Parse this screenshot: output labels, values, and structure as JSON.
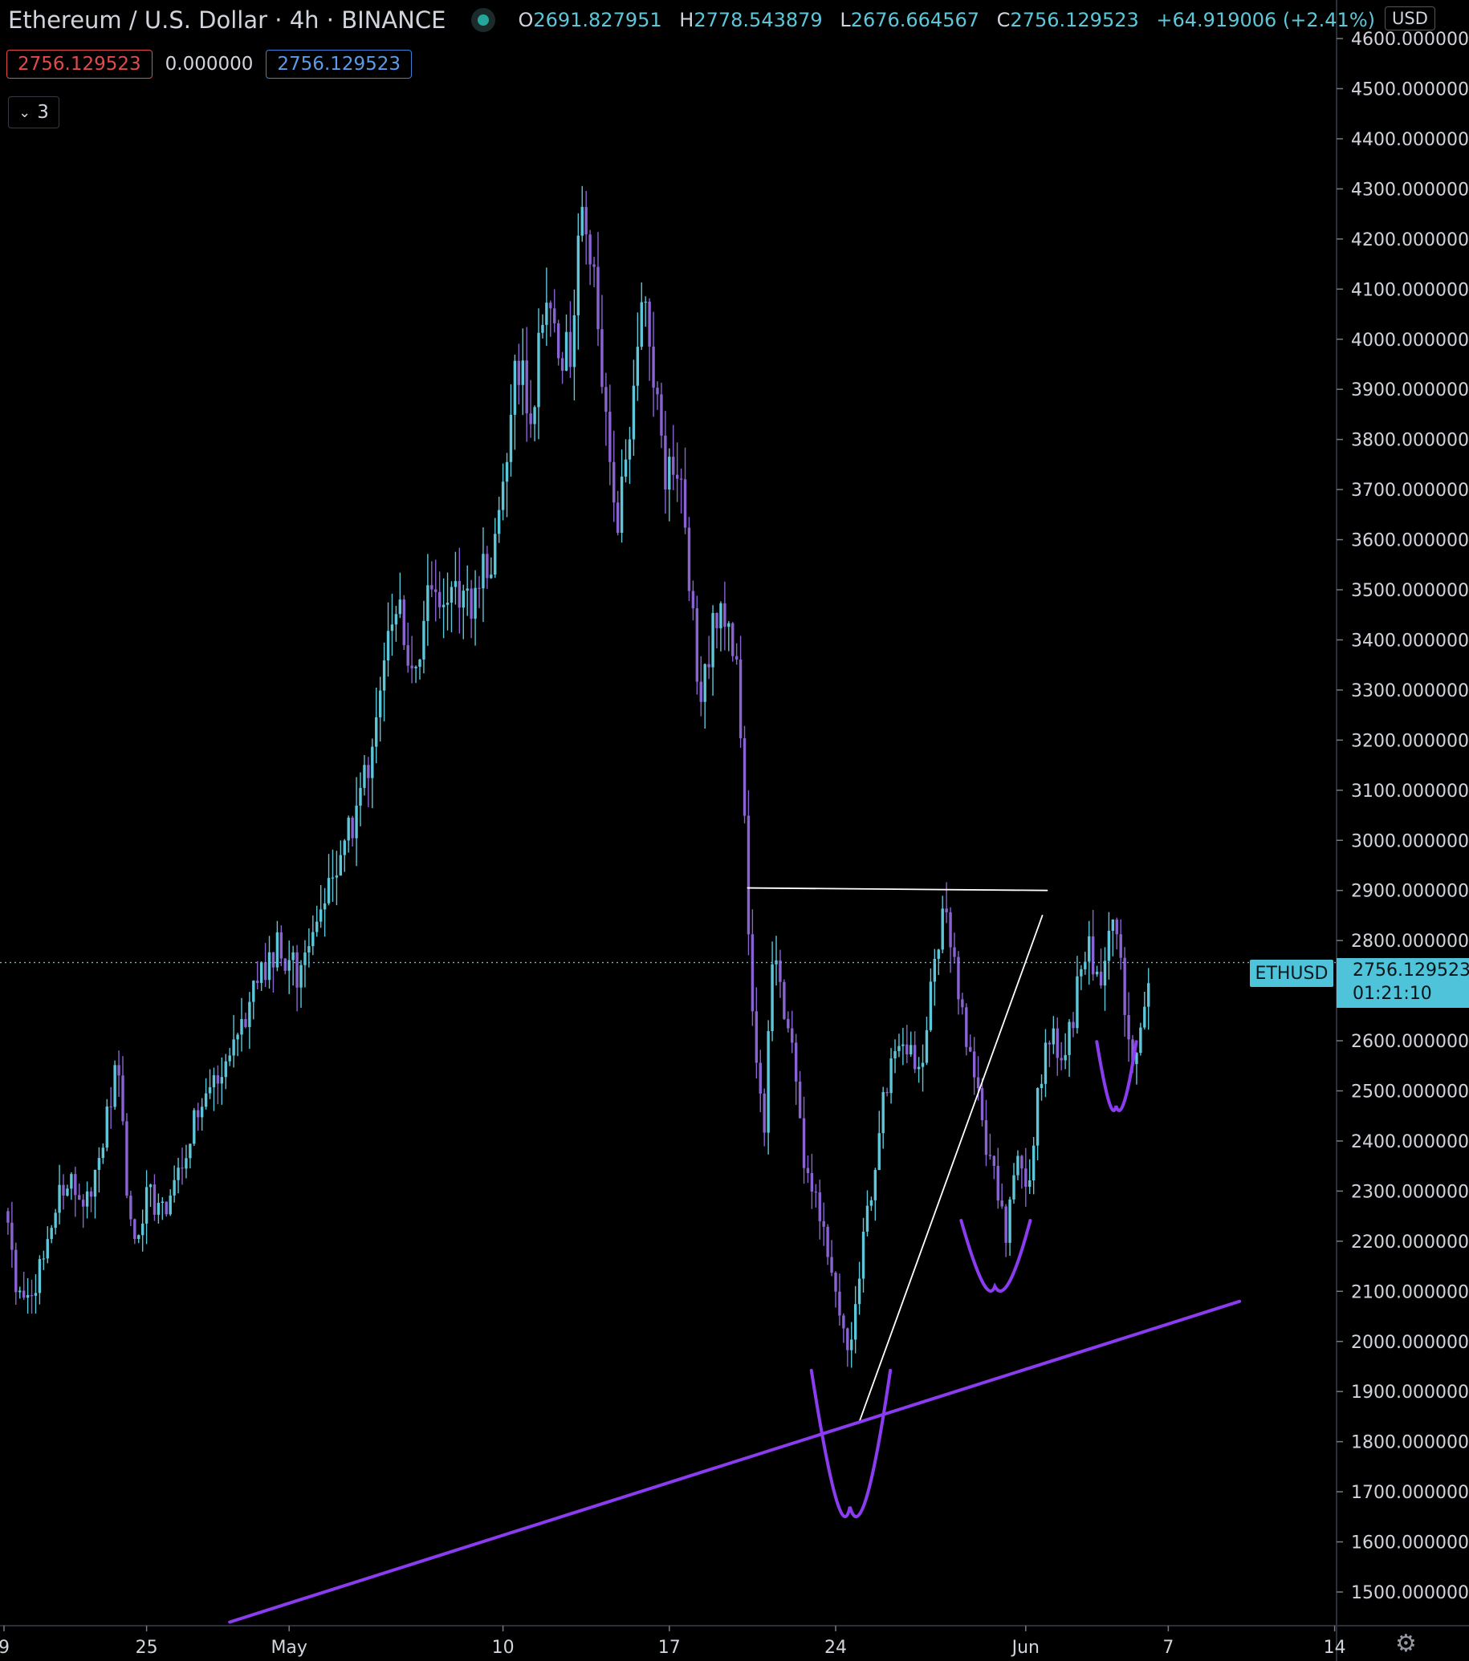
{
  "header": {
    "title": "Ethereum / U.S. Dollar · 4h · BINANCE",
    "ohlc": {
      "o_label": "O",
      "o": "2691.827951",
      "h_label": "H",
      "h": "2778.543879",
      "l_label": "L",
      "l": "2676.664567",
      "c_label": "C",
      "c": "2756.129523",
      "change": "+64.919006 (+2.41%)"
    }
  },
  "toolbar": {
    "bid": "2756.129523",
    "spread": "0.000000",
    "ask": "2756.129523",
    "indicator_count": "3"
  },
  "axis": {
    "currency": "USD"
  },
  "price_label": {
    "symbol": "ETHUSD",
    "price": "2756.129523",
    "countdown": "01:21:10"
  },
  "colors": {
    "background": "#000000",
    "candle_up": "#5dc6d8",
    "candle_down": "#8a63d2",
    "annotation_purple": "#8b3cf0",
    "annotation_white": "#ffffff",
    "last_price": "#4fc3d9"
  },
  "chart_data": {
    "type": "candlestick",
    "title": "Ethereum / U.S. Dollar · 4h · BINANCE",
    "y_axis": {
      "ylim": [
        1450,
        4700
      ],
      "ticks": [
        1500,
        1600,
        1700,
        1800,
        1900,
        2000,
        2100,
        2200,
        2300,
        2400,
        2500,
        2600,
        2700,
        2800,
        2900,
        3000,
        3100,
        3200,
        3300,
        3400,
        3500,
        3600,
        3700,
        3800,
        3900,
        4000,
        4100,
        4200,
        4300,
        4400,
        4500,
        4600
      ],
      "tick_format": "0.000000",
      "side": "right"
    },
    "x_axis": {
      "start_day": 19,
      "end_day": 57.6,
      "labels": [
        {
          "text": "9",
          "day": 19
        },
        {
          "text": "25",
          "day": 25
        },
        {
          "text": "May",
          "day": 31
        },
        {
          "text": "10",
          "day": 40
        },
        {
          "text": "17",
          "day": 47
        },
        {
          "text": "24",
          "day": 54
        },
        {
          "text": "Jun",
          "day": 62
        },
        {
          "text": "7",
          "day": 68
        },
        {
          "text": "14",
          "day": 75
        }
      ]
    },
    "close_path": [
      [
        19.0,
        2260
      ],
      [
        19.5,
        2120
      ],
      [
        20.2,
        2080
      ],
      [
        21.0,
        2250
      ],
      [
        21.8,
        2330
      ],
      [
        22.5,
        2280
      ],
      [
        23.2,
        2420
      ],
      [
        23.8,
        2560
      ],
      [
        24.2,
        2280
      ],
      [
        24.6,
        2180
      ],
      [
        25.0,
        2300
      ],
      [
        25.6,
        2250
      ],
      [
        26.2,
        2300
      ],
      [
        27.0,
        2430
      ],
      [
        27.8,
        2520
      ],
      [
        28.4,
        2580
      ],
      [
        29.0,
        2640
      ],
      [
        29.8,
        2720
      ],
      [
        30.6,
        2790
      ],
      [
        31.3,
        2730
      ],
      [
        32.0,
        2830
      ],
      [
        32.5,
        2910
      ],
      [
        33.0,
        2950
      ],
      [
        33.8,
        3040
      ],
      [
        34.5,
        3200
      ],
      [
        35.0,
        3380
      ],
      [
        35.6,
        3480
      ],
      [
        36.2,
        3300
      ],
      [
        37.0,
        3520
      ],
      [
        37.8,
        3490
      ],
      [
        38.5,
        3460
      ],
      [
        39.2,
        3550
      ],
      [
        39.8,
        3600
      ],
      [
        40.5,
        3960
      ],
      [
        41.2,
        3850
      ],
      [
        41.8,
        4080
      ],
      [
        42.3,
        4000
      ],
      [
        42.8,
        3960
      ],
      [
        43.3,
        4280
      ],
      [
        43.8,
        4120
      ],
      [
        44.3,
        3850
      ],
      [
        44.8,
        3600
      ],
      [
        45.3,
        3800
      ],
      [
        45.8,
        4100
      ],
      [
        46.3,
        3950
      ],
      [
        46.8,
        3700
      ],
      [
        47.3,
        3760
      ],
      [
        47.8,
        3560
      ],
      [
        48.3,
        3270
      ],
      [
        48.8,
        3420
      ],
      [
        49.3,
        3460
      ],
      [
        49.8,
        3380
      ],
      [
        50.2,
        2980
      ],
      [
        50.6,
        2580
      ],
      [
        51.0,
        2430
      ],
      [
        51.4,
        2830
      ],
      [
        51.8,
        2640
      ],
      [
        52.2,
        2560
      ],
      [
        52.6,
        2380
      ],
      [
        53.0,
        2320
      ],
      [
        53.5,
        2200
      ],
      [
        54.0,
        2080
      ],
      [
        54.6,
        1960
      ],
      [
        55.0,
        2140
      ],
      [
        55.5,
        2300
      ],
      [
        56.0,
        2480
      ],
      [
        56.6,
        2620
      ],
      [
        57.2,
        2590
      ],
      [
        57.6,
        2550
      ],
      [
        58.0,
        2720
      ],
      [
        58.6,
        2860
      ],
      [
        59.2,
        2690
      ],
      [
        59.7,
        2540
      ],
      [
        60.2,
        2430
      ],
      [
        60.7,
        2330
      ],
      [
        61.2,
        2210
      ],
      [
        61.6,
        2360
      ],
      [
        62.1,
        2300
      ],
      [
        62.6,
        2520
      ],
      [
        63.1,
        2620
      ],
      [
        63.6,
        2560
      ],
      [
        64.1,
        2680
      ],
      [
        64.6,
        2790
      ],
      [
        65.1,
        2700
      ],
      [
        65.6,
        2850
      ],
      [
        66.0,
        2760
      ],
      [
        66.4,
        2560
      ],
      [
        66.9,
        2650
      ],
      [
        67.2,
        2756
      ]
    ],
    "annotations": [
      {
        "type": "horizontal-resistance",
        "color": "white",
        "points": [
          [
            50.3,
            2905
          ],
          [
            62.9,
            2900
          ]
        ]
      },
      {
        "type": "rising-trendline",
        "color": "white",
        "points": [
          [
            55.0,
            1840
          ],
          [
            62.7,
            2850
          ]
        ]
      },
      {
        "type": "long-term-support",
        "color": "purple",
        "points": [
          [
            28.5,
            1440
          ],
          [
            71.0,
            2080
          ]
        ]
      },
      {
        "type": "arc-low-1",
        "color": "purple",
        "center": [
          54.6,
          1670
        ]
      },
      {
        "type": "arc-low-2",
        "color": "purple",
        "center": [
          60.7,
          2110
        ]
      },
      {
        "type": "arc-low-3",
        "color": "purple",
        "center": [
          65.8,
          2470
        ]
      }
    ],
    "last_price": 2756.129523
  }
}
